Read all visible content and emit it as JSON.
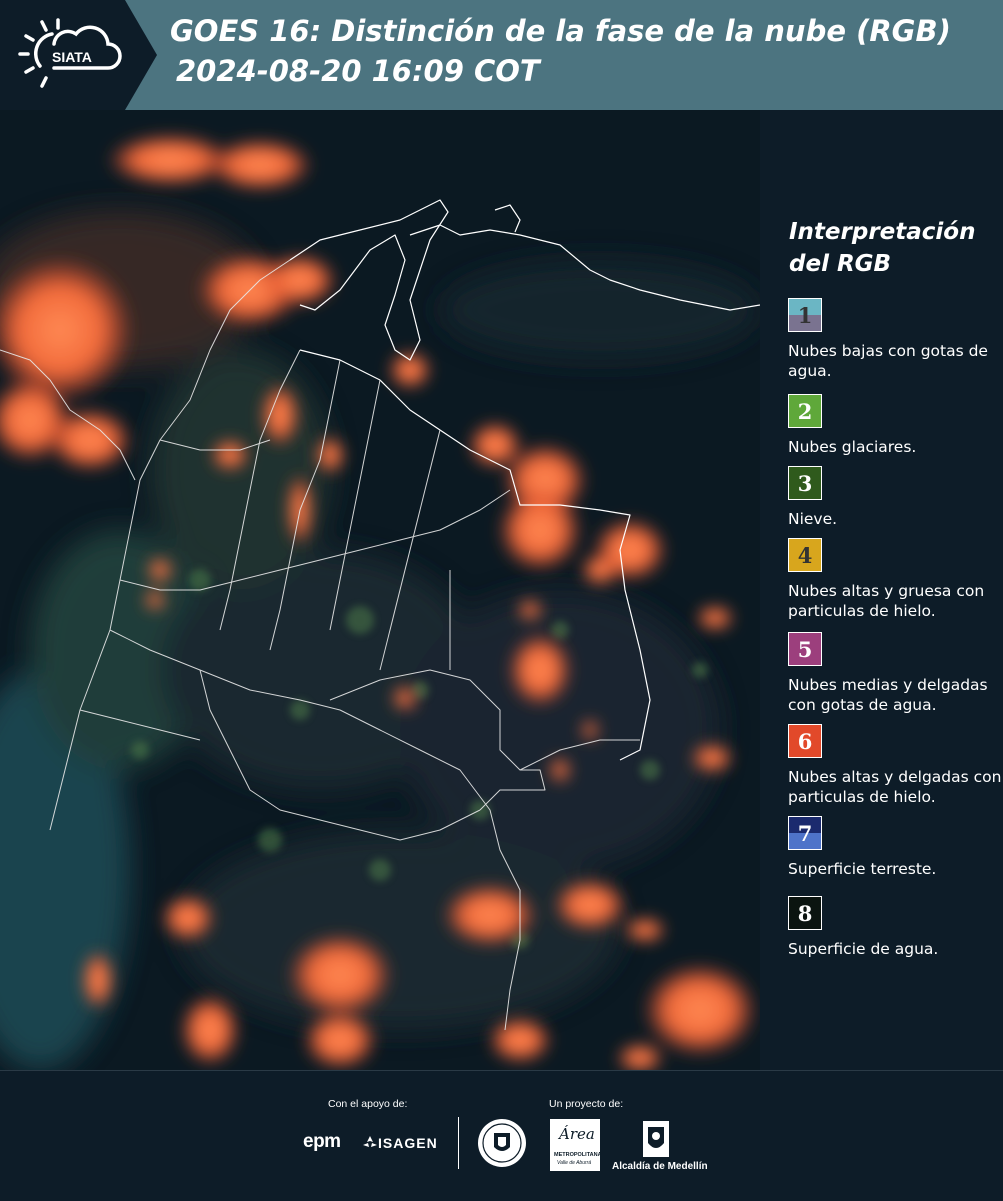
{
  "header": {
    "logo_text": "SIATA",
    "title_line1": "GOES 16: Distinción de la fase de la nube (RGB)",
    "title_line2": "2024-08-20 16:09 COT"
  },
  "legend": {
    "title": "Interpretación del RGB",
    "items": [
      {
        "number": "1",
        "label": "Nubes bajas con gotas de agua.",
        "color_top": "#6bb6c4",
        "color_bottom": "#7a7390",
        "text_color": "#333333"
      },
      {
        "number": "2",
        "label": "Nubes glaciares.",
        "color_top": "#5fa83a",
        "color_bottom": "#5fa83a",
        "text_color": "#ffffff"
      },
      {
        "number": "3",
        "label": "Nieve.",
        "color_top": "#2f5a1c",
        "color_bottom": "#2f5a1c",
        "text_color": "#ffffff"
      },
      {
        "number": "4",
        "label": "Nubes altas y gruesa con particulas de hielo.",
        "color_top": "#d8a61d",
        "color_bottom": "#d8a61d",
        "text_color": "#333333"
      },
      {
        "number": "5",
        "label": "Nubes medias y delgadas con gotas de agua.",
        "color_top": "#9c3f7d",
        "color_bottom": "#9c3f7d",
        "text_color": "#ffffff"
      },
      {
        "number": "6",
        "label": "Nubes altas y delgadas con particulas de hielo.",
        "color_top": "#e2492a",
        "color_bottom": "#e2492a",
        "text_color": "#ffffff"
      },
      {
        "number": "7",
        "label": "Superficie terreste.",
        "color_top": "#1b2a6e",
        "color_bottom": "#4e73c9",
        "text_color": "#ffffff"
      },
      {
        "number": "8",
        "label": "Superficie de agua.",
        "color_top": "#0b1410",
        "color_bottom": "#0b1410",
        "text_color": "#ffffff"
      }
    ]
  },
  "footer": {
    "support_label": "Con el apoyo de:",
    "project_label": "Un proyecto de:",
    "sponsor_epm": "epm",
    "sponsor_isagen": "ISAGEN",
    "partner_area_line1": "Área",
    "partner_area_line2": "METROPOLITANA",
    "partner_area_line3": "Valle de Aburrá",
    "partner_alcaldia": "Alcaldía de Medellín"
  },
  "colors": {
    "header_band": "#4c7480",
    "background": "#0d1c28",
    "cloud_orange": "#f26a3a"
  },
  "icons": [
    "sun-cloud-logo-icon",
    "epm-logo-icon",
    "isagen-logo-icon",
    "university-seal-icon",
    "area-metropolitana-logo-icon",
    "alcaldia-shield-icon"
  ]
}
